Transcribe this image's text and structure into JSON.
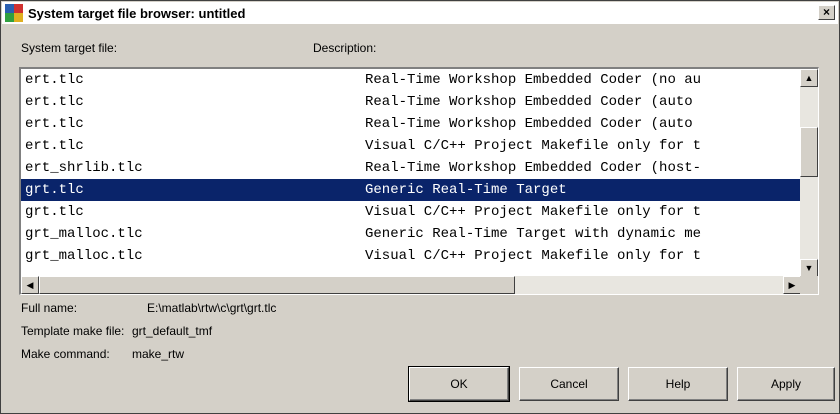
{
  "window": {
    "title": "System target file browser: untitled",
    "close_glyph": "×"
  },
  "columns": {
    "file": "System target file:",
    "description": "Description:"
  },
  "rows": [
    {
      "file": "ert.tlc",
      "desc": "Real-Time Workshop Embedded Coder (no au",
      "selected": false
    },
    {
      "file": "ert.tlc",
      "desc": "Real-Time Workshop Embedded Coder (auto",
      "selected": false
    },
    {
      "file": "ert.tlc",
      "desc": "Real-Time Workshop Embedded Coder (auto",
      "selected": false
    },
    {
      "file": "ert.tlc",
      "desc": "Visual C/C++ Project Makefile only for t",
      "selected": false
    },
    {
      "file": "ert_shrlib.tlc",
      "desc": "Real-Time Workshop Embedded Coder (host-",
      "selected": false
    },
    {
      "file": "grt.tlc",
      "desc": "Generic Real-Time Target",
      "selected": true
    },
    {
      "file": "grt.tlc",
      "desc": "Visual C/C++ Project Makefile only for t",
      "selected": false
    },
    {
      "file": "grt_malloc.tlc",
      "desc": "Generic Real-Time Target with dynamic me",
      "selected": false
    },
    {
      "file": "grt_malloc.tlc",
      "desc": "Visual C/C++ Project Makefile only for t",
      "selected": false
    }
  ],
  "details": {
    "full_name_label": "Full name:",
    "full_name_value": "E:\\matlab\\rtw\\c\\grt\\grt.tlc",
    "template_label": "Template make file:",
    "template_value": "grt_default_tmf",
    "make_label": "Make command:",
    "make_value": "make_rtw"
  },
  "buttons": {
    "ok": "OK",
    "cancel": "Cancel",
    "help": "Help",
    "apply": "Apply"
  },
  "icons": {
    "scroll_up": "▲",
    "scroll_down": "▼",
    "scroll_left": "◀",
    "scroll_right": "▶"
  }
}
